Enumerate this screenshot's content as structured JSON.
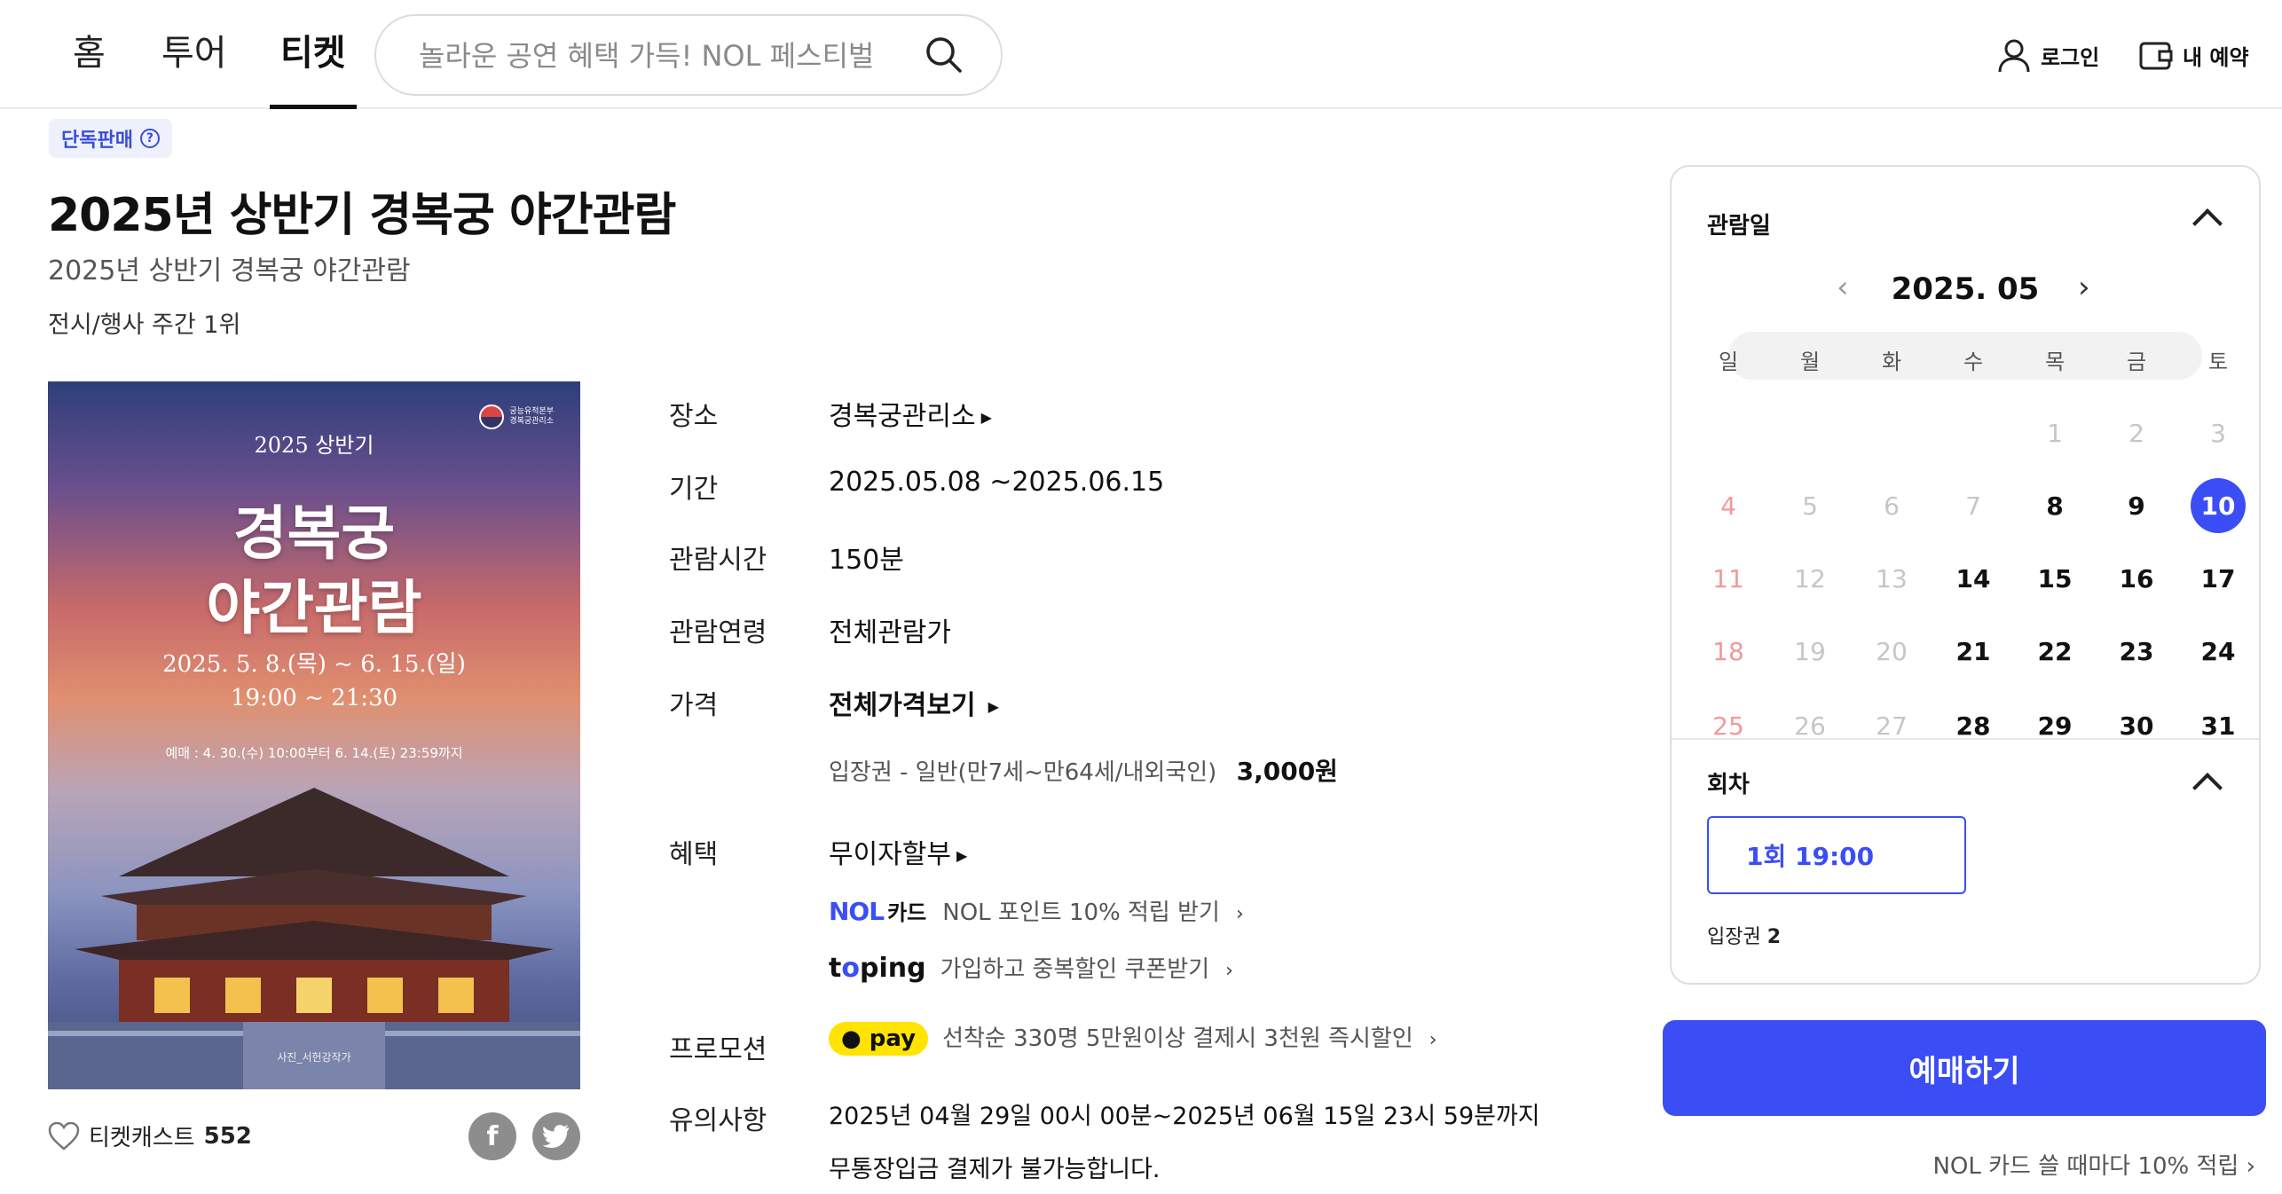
{
  "header": {
    "tabs": [
      {
        "label": "홈"
      },
      {
        "label": "투어"
      },
      {
        "label": "티켓",
        "active": true
      }
    ],
    "search_placeholder": "놀라운 공연 혜택 가득! NOL 페스티벌",
    "login_label": "로그인",
    "my_booking_label": "내 예약"
  },
  "product": {
    "badge": "단독판매",
    "title": "2025년 상반기 경복궁 야간관람",
    "subtitle": "2025년 상반기 경복궁 야간관람",
    "rank": "전시/행사 주간 1위"
  },
  "poster": {
    "year_line": "2025 상반기",
    "title_line1": "경복궁",
    "title_line2": "야간관람",
    "date_line": "2025. 5. 8.(목) ~ 6. 15.(일)",
    "time_line": "19:00 ~ 21:30",
    "presale_line": "예매 : 4. 30.(수) 10:00부터 6. 14.(토) 23:59까지",
    "credit": "사진_서헌강작가",
    "org_line1": "궁능유적본부",
    "org_line2": "경복궁관리소"
  },
  "ticketcast": {
    "label": "티켓캐스트",
    "count": "552"
  },
  "info": {
    "venue_label": "장소",
    "venue": "경복궁관리소",
    "period_label": "기간",
    "period": "2025.05.08 ~2025.06.15",
    "duration_label": "관람시간",
    "duration": "150분",
    "age_label": "관람연령",
    "age": "전체관람가",
    "price_label": "가격",
    "price_link": "전체가격보기",
    "price_item": "입장권 - 일반(만7세~만64세/내외국인)",
    "price_value": "3,000원",
    "benefit_label": "혜택",
    "benefit_main": "무이자할부",
    "nol_logo": "NOL",
    "nol_card": "카드",
    "nol_benefit": "NOL 포인트 10% 적립 받기",
    "toping_logo_a": "t",
    "toping_logo_dot": "o",
    "toping_logo_b": "ping",
    "toping_benefit": "가입하고 중복할인 쿠폰받기",
    "promo_label": "프로모션",
    "promo_pay": "pay",
    "promo_text": "선착순 330명 5만원이상 결제시 3천원 즉시할인",
    "notice_label": "유의사항",
    "notice_line1": "2025년 04월 29일 00시 00분~2025년 06월 15일 23시 59분까지",
    "notice_line2": "무통장입금 결제가 불가능합니다."
  },
  "booking": {
    "date_section": "관람일",
    "month": "2025. 05",
    "weekdays": [
      "일",
      "월",
      "화",
      "수",
      "목",
      "금",
      "토"
    ],
    "weeks": [
      [
        "",
        "",
        "",
        "",
        "1",
        "2",
        "3"
      ],
      [
        "4",
        "5",
        "6",
        "7",
        "8",
        "9",
        "10"
      ],
      [
        "11",
        "12",
        "13",
        "14",
        "15",
        "16",
        "17"
      ],
      [
        "18",
        "19",
        "20",
        "21",
        "22",
        "23",
        "24"
      ],
      [
        "25",
        "26",
        "27",
        "28",
        "29",
        "30",
        "31"
      ]
    ],
    "available_days": [
      "8",
      "9",
      "10",
      "14",
      "15",
      "16",
      "17",
      "21",
      "22",
      "23",
      "24",
      "28",
      "29",
      "30",
      "31"
    ],
    "selected_day": "10",
    "round_section": "회차",
    "round_option": "1회 19:00",
    "ticket_label": "입장권",
    "ticket_count": "2",
    "book_button": "예매하기",
    "nol_promo": "NOL 카드 쓸 때마다 10% 적립"
  },
  "colors": {
    "accent": "#3b4ef5",
    "sunday": "#e23b3b",
    "kakao_pay": "#ffe400"
  }
}
